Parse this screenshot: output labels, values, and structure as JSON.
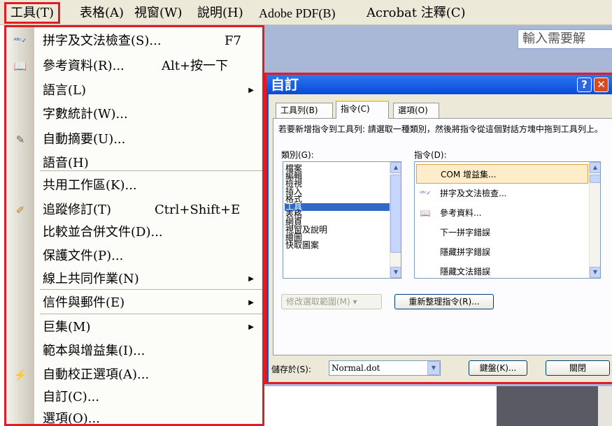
{
  "menubar": {
    "items": [
      "工具(T)",
      "表格(A)",
      "視窗(W)",
      "說明(H)",
      "Adobe PDF(B)",
      "Acrobat 注釋(C)"
    ]
  },
  "help_search": {
    "placeholder": "輸入需要解"
  },
  "tools_menu": {
    "items": [
      {
        "label": "拼字及文法檢查(S)...",
        "shortcut": "F7",
        "icon": "abc-check-icon"
      },
      {
        "label": "參考資料(R)...",
        "shortcut": "Alt+按一下",
        "icon": "book-icon"
      },
      {
        "label": "語言(L)",
        "submenu": true
      },
      {
        "label": "字數統計(W)..."
      },
      {
        "label": "自動摘要(U)...",
        "icon": "summary-icon"
      },
      {
        "label": "語音(H)"
      },
      {
        "label": "共用工作區(K)..."
      },
      {
        "label": "追蹤修訂(T)",
        "shortcut": "Ctrl+Shift+E",
        "icon": "track-changes-icon"
      },
      {
        "label": "比較並合併文件(D)..."
      },
      {
        "label": "保護文件(P)..."
      },
      {
        "label": "線上共同作業(N)",
        "submenu": true
      },
      {
        "label": "信件與郵件(E)",
        "submenu": true
      },
      {
        "label": "巨集(M)",
        "submenu": true
      },
      {
        "label": "範本與增益集(I)..."
      },
      {
        "label": "自動校正選項(A)...",
        "icon": "autocorrect-icon"
      },
      {
        "label": "自訂(C)..."
      },
      {
        "label": "選項(O)..."
      }
    ]
  },
  "dialog": {
    "title": "自訂",
    "help_button": "?",
    "close_button": "✕",
    "tabs": [
      "工具列(B)",
      "指令(C)",
      "選項(O)"
    ],
    "active_tab": 1,
    "instructions": "若要新增指令到工具列: 請選取一種類別，然後將指令從這個對話方塊中拖到工具列上。",
    "categories_label": "類別(G):",
    "categories": [
      "檔案",
      "編輯",
      "檢視",
      "插入",
      "格式",
      "工具",
      "表格",
      "網頁",
      "視窗及說明",
      "繪圖",
      "快取圖案"
    ],
    "selected_category": "工具",
    "commands_label": "指令(D):",
    "commands": [
      {
        "label": "COM 增益集...",
        "selected": true
      },
      {
        "label": "拼字及文法檢查...",
        "icon": "abc-check-icon"
      },
      {
        "label": "參考資料...",
        "icon": "book-icon"
      },
      {
        "label": "下一拼字錯誤"
      },
      {
        "label": "隱藏拼字錯誤"
      },
      {
        "label": "隱藏文法錯誤"
      }
    ],
    "modify_selection": "修改選取範圍(M) ▾",
    "rearrange_commands": "重新整理指令(R)...",
    "save_in_label": "儲存於(S):",
    "save_in_value": "Normal.dot",
    "keyboard_button": "鍵盤(K)...",
    "close_label": "關閉"
  },
  "colors": {
    "highlight_red": "#e31b23",
    "title_blue": "#0a55e4",
    "selection_blue": "#316ac5"
  }
}
